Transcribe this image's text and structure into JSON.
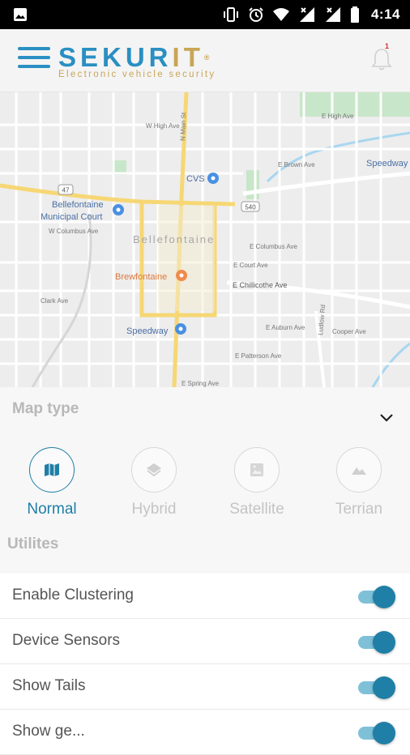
{
  "status_bar": {
    "time": "4:14"
  },
  "header": {
    "logo_part1": "SEKUR",
    "logo_part2": "IT",
    "logo_reg": "®",
    "tagline": "Electronic vehicle security",
    "notification_count": "1"
  },
  "map": {
    "labels": {
      "cvs": "CVS",
      "bellefontaine_court": "Bellefontaine",
      "municipal_court": "Municipal Court",
      "town": "Bellefontaine",
      "brewfontaine": "Brewfontaine",
      "speedway_center": "Speedway",
      "speedway_right": "Speedway",
      "chillicothe": "E Chillicothe Ave",
      "main_st": "N Main St",
      "high_ave": "W High Ave",
      "brown_ave": "E Brown Ave",
      "high_ave_e": "E High Ave",
      "columbus_w": "W Columbus Ave",
      "columbus_e": "E Columbus Ave",
      "court_ave": "E Court Ave",
      "clark_ave": "Clark Ave",
      "auburn_ave": "E Auburn Ave",
      "cooper_ave": "Cooper Ave",
      "patterson_ave": "E Patterson Ave",
      "spring_ave": "E Spring Ave",
      "ludlow_rd": "Ludlow Rd",
      "shield_47": "47",
      "shield_540": "540"
    },
    "colors": {
      "highlight_road": "#f6d774",
      "water": "#a9d6f0",
      "park": "#c8e6c9"
    }
  },
  "map_type": {
    "heading": "Map type",
    "options": [
      {
        "label": "Normal",
        "icon": "map-icon",
        "active": true
      },
      {
        "label": "Hybrid",
        "icon": "layers-icon",
        "active": false
      },
      {
        "label": "Satellite",
        "icon": "satellite-icon",
        "active": false
      },
      {
        "label": "Terrian",
        "icon": "terrain-icon",
        "active": false
      }
    ]
  },
  "utilities": {
    "heading": "Utilites",
    "rows": [
      {
        "label": "Enable Clustering",
        "on": true
      },
      {
        "label": "Device Sensors",
        "on": true
      },
      {
        "label": "Show Tails",
        "on": true
      },
      {
        "label": "Show ge...",
        "on": true
      }
    ]
  },
  "accent_color": "#1f7fa6"
}
